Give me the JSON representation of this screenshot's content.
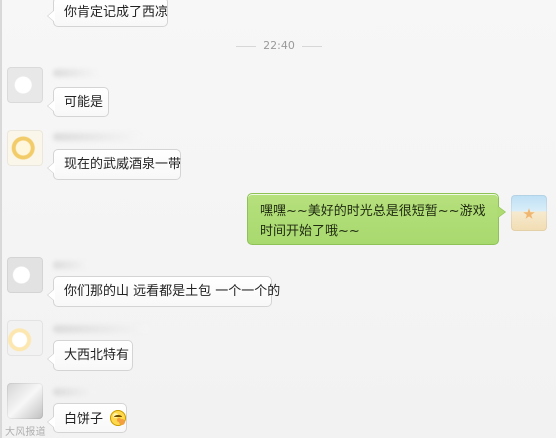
{
  "chat": {
    "timestamp": "22:40",
    "messages": [
      {
        "text": "你肯定记成了西凉"
      },
      {
        "text": "可能是"
      },
      {
        "text": "现在的武威酒泉一带"
      },
      {
        "text": "嘿嘿~~美好的时光总是很短暂~~游戏时间开始了哦~~"
      },
      {
        "text": "你们那的山 远看都是土包 一个一个的"
      },
      {
        "text": "大西北特有"
      },
      {
        "text": "白饼子"
      }
    ]
  },
  "icons": {
    "emoji": "grinning-emoji-icon"
  },
  "watermark": "大风报道"
}
